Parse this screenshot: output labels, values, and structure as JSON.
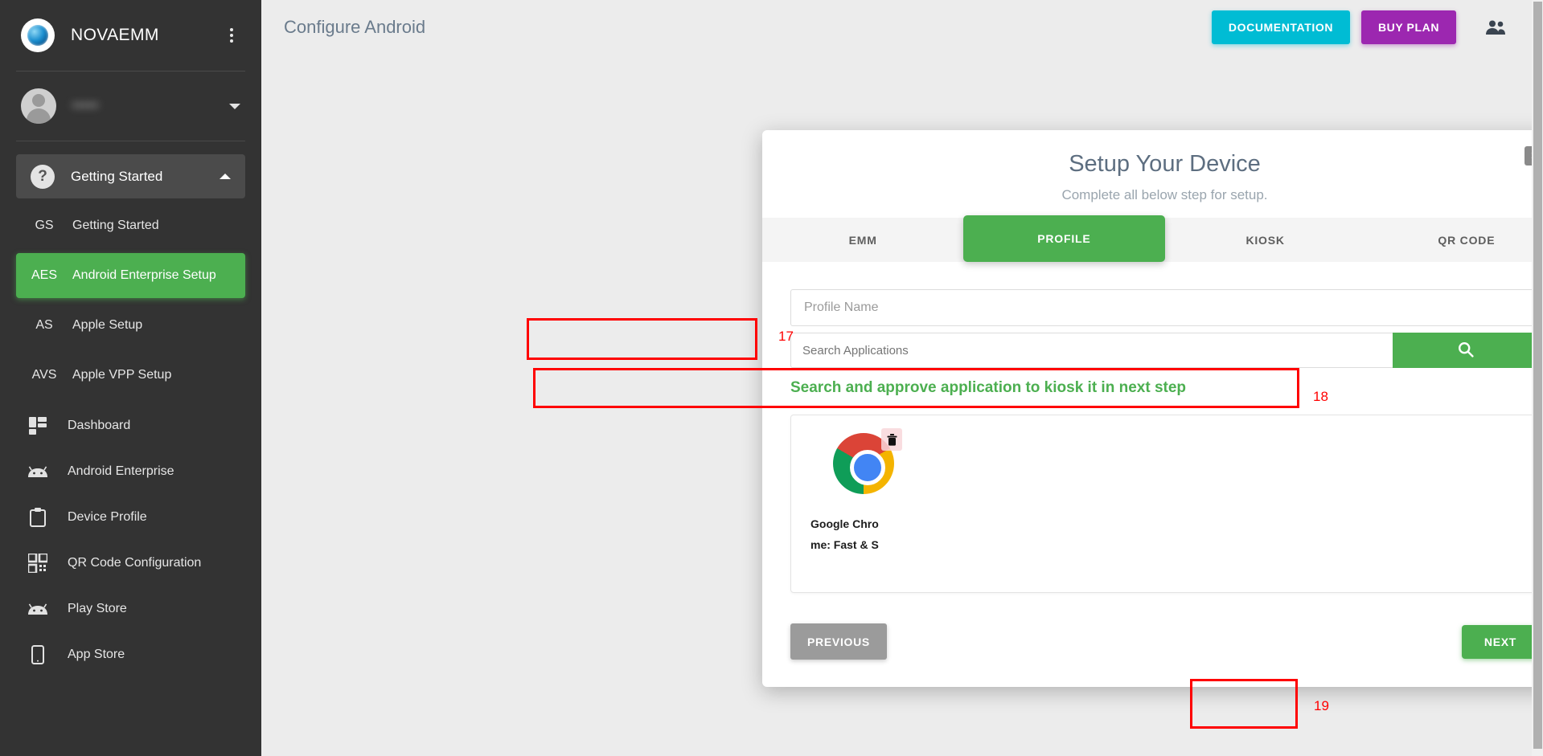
{
  "sidebar": {
    "brand": {
      "name": "NOVAEMM",
      "logo_icon": "circle-logo-icon",
      "menu_icon": "kebab-menu-icon"
    },
    "user": {
      "name": "",
      "avatar_icon": "avatar-icon",
      "caret_icon": "chevron-down-icon"
    },
    "group": {
      "label": "Getting Started",
      "icon": "question-mark-icon",
      "caret_icon": "chevron-up-icon",
      "sub_items": [
        {
          "abbr": "GS",
          "label": "Getting Started",
          "active": false
        },
        {
          "abbr": "AES",
          "label": "Android Enterprise Setup",
          "active": true
        },
        {
          "abbr": "AS",
          "label": "Apple Setup",
          "active": false
        },
        {
          "abbr": "AVS",
          "label": "Apple VPP Setup",
          "active": false
        }
      ]
    },
    "items": [
      {
        "label": "Dashboard",
        "icon": "dashboard-grid-icon"
      },
      {
        "label": "Android Enterprise",
        "icon": "android-icon"
      },
      {
        "label": "Device Profile",
        "icon": "clipboard-icon"
      },
      {
        "label": "QR Code Configuration",
        "icon": "qr-code-icon"
      },
      {
        "label": "Play Store",
        "icon": "android-icon"
      },
      {
        "label": "App Store",
        "icon": "mobile-phone-icon"
      }
    ]
  },
  "topbar": {
    "title": "Configure Android",
    "documentation_label": "DOCUMENTATION",
    "buy_plan_label": "BUY PLAN",
    "people_icon": "people-icon",
    "accent_documentation": "#00BCD4",
    "accent_buy_plan": "#9C27B0"
  },
  "modal": {
    "title": "Setup Your Device",
    "subtitle": "Complete all below step for setup.",
    "close_icon": "close-icon",
    "tabs": [
      {
        "label": "EMM",
        "active": false
      },
      {
        "label": "PROFILE",
        "active": true
      },
      {
        "label": "KIOSK",
        "active": false
      },
      {
        "label": "QR CODE",
        "active": false
      }
    ],
    "profile_name": {
      "placeholder": "Profile Name",
      "value": ""
    },
    "search": {
      "placeholder": "Search Applications",
      "value": "",
      "button_icon": "search-icon"
    },
    "hint": "Search and approve application to kiosk it in next step",
    "apps": [
      {
        "name_line1": "Google Chro",
        "name_line2": "me: Fast & S",
        "icon": "chrome-icon",
        "delete_icon": "trash-icon"
      }
    ],
    "previous_label": "PREVIOUS",
    "next_label": "NEXT",
    "accent_green": "#4CAF50"
  },
  "annotations": [
    {
      "id": "17",
      "target": "profile-name-input"
    },
    {
      "id": "18",
      "target": "search-applications-row"
    },
    {
      "id": "19",
      "target": "next-button"
    }
  ]
}
